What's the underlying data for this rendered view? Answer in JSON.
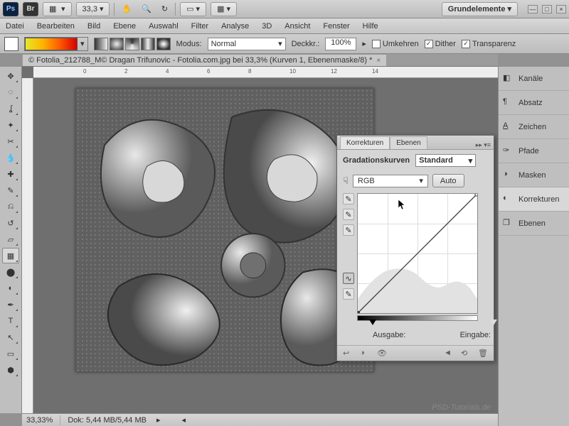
{
  "app": {
    "ps": "Ps",
    "br": "Br",
    "zoom_dd": "33,3",
    "workspace": "Grundelemente"
  },
  "menu": [
    "Datei",
    "Bearbeiten",
    "Bild",
    "Ebene",
    "Auswahl",
    "Filter",
    "Analyse",
    "3D",
    "Ansicht",
    "Fenster",
    "Hilfe"
  ],
  "opt": {
    "modus_label": "Modus:",
    "modus_val": "Normal",
    "deckkr_label": "Deckkr.:",
    "deckkr_val": "100%",
    "umkehren": "Umkehren",
    "dither": "Dither",
    "transparenz": "Transparenz"
  },
  "doc": {
    "title": "© Fotolia_212788_M© Dragan Trifunovic - Fotolia.com.jpg bei 33,3% (Kurven 1, Ebenenmaske/8) *"
  },
  "ruler": {
    "marks": [
      "0",
      "2",
      "4",
      "6",
      "8",
      "10",
      "12",
      "14"
    ]
  },
  "curves": {
    "tab1": "Korrekturen",
    "tab2": "Ebenen",
    "title": "Gradationskurven",
    "preset": "Standard",
    "channel": "RGB",
    "auto": "Auto",
    "ausgabe": "Ausgabe:",
    "eingabe": "Eingabe:"
  },
  "dock": {
    "items": [
      "Kanäle",
      "Absatz",
      "Zeichen",
      "Pfade",
      "Masken",
      "Korrekturen",
      "Ebenen"
    ]
  },
  "status": {
    "zoom": "33,33%",
    "dok": "Dok: 5,44 MB/5,44 MB"
  },
  "watermark": "PSD-Tutorials.de"
}
